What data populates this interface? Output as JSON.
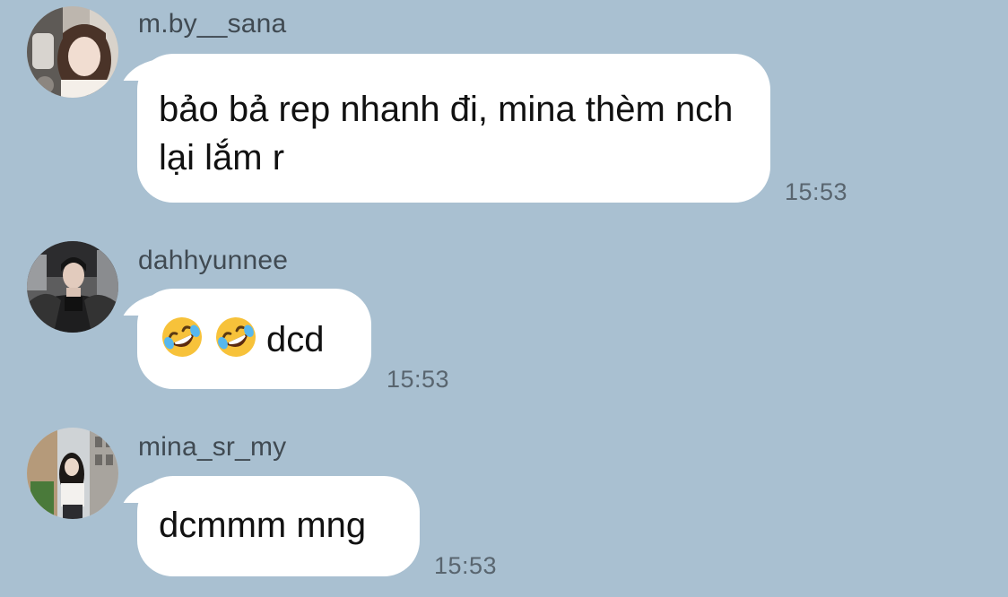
{
  "colors": {
    "background": "#a9c0d1",
    "bubble": "#ffffff",
    "sender_text": "#404a52",
    "message_text": "#111111",
    "timestamp_text": "#59656f"
  },
  "messages": [
    {
      "sender": "m.by__sana",
      "avatar": "avatar-photo",
      "text": "bảo bả rep nhanh đi, mina thèm nch lại lắm r",
      "time": "15:53"
    },
    {
      "sender": "dahhyunnee",
      "avatar": "avatar-photo",
      "emojis": [
        "rolling-on-floor-laughing-emoji",
        "rolling-on-floor-laughing-emoji"
      ],
      "text": "dcd",
      "time": "15:53"
    },
    {
      "sender": "mina_sr_my",
      "avatar": "avatar-photo",
      "text": "dcmmm mng",
      "time": "15:53"
    }
  ]
}
